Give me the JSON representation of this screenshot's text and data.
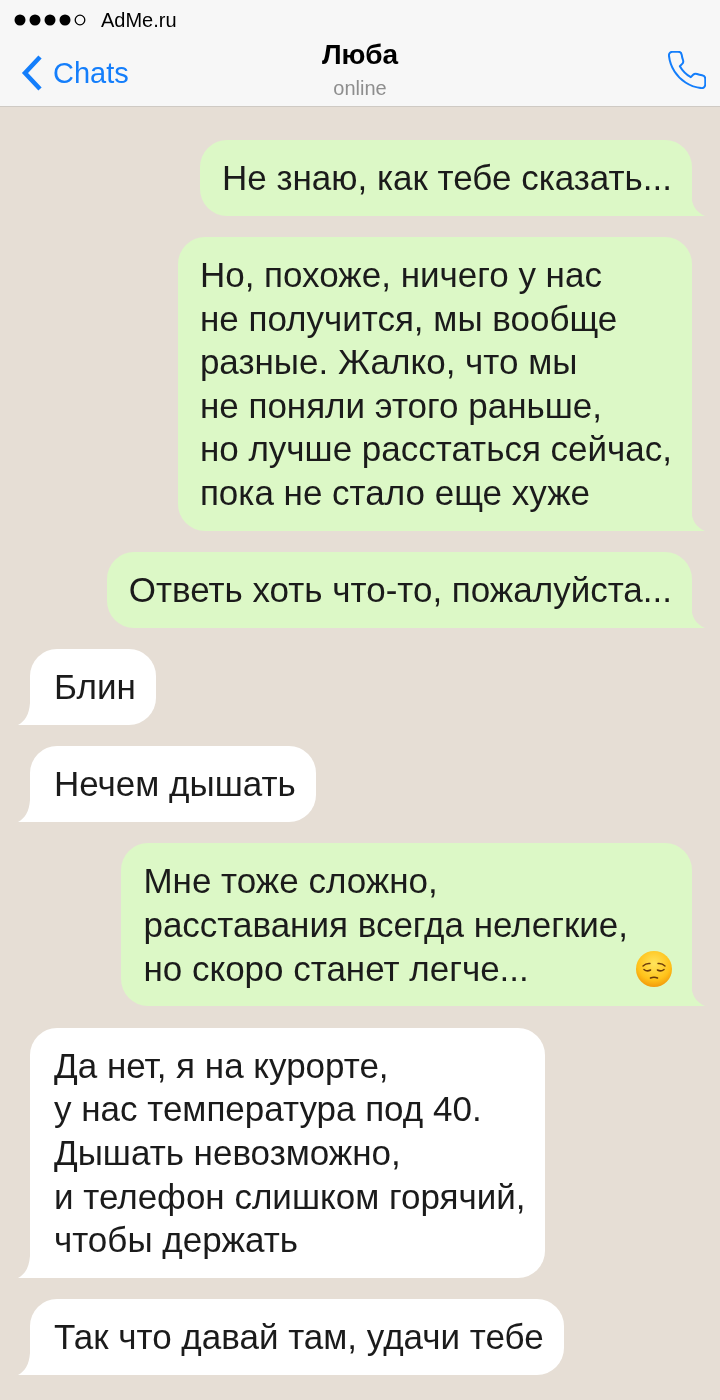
{
  "status_bar": {
    "carrier": "AdMe.ru"
  },
  "nav": {
    "back_label": "Chats",
    "title": "Люба",
    "subtitle": "online"
  },
  "messages": [
    {
      "kind": "outgoing",
      "text": "Не знаю, как тебе сказать..."
    },
    {
      "kind": "outgoing",
      "text": "Но, похоже, ничего у нас\nне получится, мы вообще\nразные. Жалко, что мы\nне поняли этого раньше,\nно лучше расстаться сейчас,\nпока не стало еще хуже"
    },
    {
      "kind": "outgoing",
      "text": "Ответь хоть что-то, пожалуйста..."
    },
    {
      "kind": "incoming",
      "text": "Блин"
    },
    {
      "kind": "incoming",
      "text": "Нечем дышать"
    },
    {
      "kind": "outgoing",
      "text": "Мне тоже сложно,\nрасставания всегда нелегкие,\nно скоро станет легче...",
      "emoji": true
    },
    {
      "kind": "incoming",
      "text": "Да нет, я на курорте,\nу нас температура под 40.\nДышать невозможно,\nи телефон слишком горячий,\nчтобы держать"
    },
    {
      "kind": "incoming",
      "text": "Так что давай там, удачи тебе"
    }
  ]
}
